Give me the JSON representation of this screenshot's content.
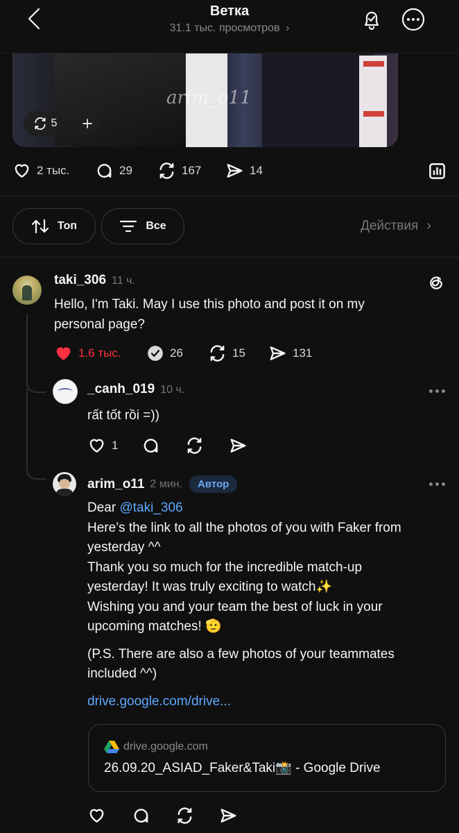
{
  "header": {
    "title": "Ветка",
    "views": "31.1 тыс. просмотров"
  },
  "media": {
    "watermark": "arim_o11",
    "repost_count": "5"
  },
  "post_actions": {
    "likes": "2 тыс.",
    "comments": "29",
    "reposts": "167",
    "shares": "14"
  },
  "filters": {
    "sort": "Топ",
    "filter": "Все",
    "actions": "Действия"
  },
  "comment": {
    "username": "taki_306",
    "time": "11 ч.",
    "lines": [
      "Hello, I'm Taki. May I use this photo and post it on my",
      "personal page?"
    ],
    "likes": "1.6 тыс.",
    "replies": "26",
    "reposts": "15",
    "shares": "131"
  },
  "reply1": {
    "username": "_canh_019",
    "time": "10 ч.",
    "text": "rất tốt rồi =))",
    "likes": "1"
  },
  "reply2": {
    "username": "arim_o11",
    "time": "2 мин.",
    "badge": "Автор",
    "greeting": "Dear ",
    "mention": "@taki_306",
    "lines": [
      "Here’s the link to all the photos of you with Faker from",
      "yesterday ^^",
      "Thank you so much for the incredible match-up",
      "yesterday! It was truly exciting to watch✨",
      "Wishing you and your team the best of luck in your",
      "upcoming matches! 🫡"
    ],
    "ps_lines": [
      "(P.S. There are also a few photos of your teammates",
      "included ^^)"
    ],
    "link": "drive.google.com/drive...",
    "card_domain": "drive.google.com",
    "card_title": "26.09.20_ASIAD_Faker&Taki📸 - Google Drive"
  },
  "colors": {
    "background": "#101010",
    "text": "#f3f5f7",
    "muted": "#8a8a8a",
    "like_red": "#ff3040",
    "link_blue": "#5fa8ff"
  }
}
